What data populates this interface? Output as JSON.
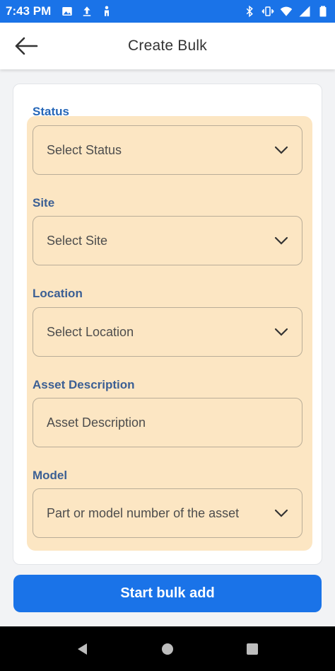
{
  "status_bar": {
    "time": "7:43 PM",
    "left_icons": [
      "image-icon",
      "upload-icon",
      "accessibility-icon"
    ],
    "right_icons": [
      "bluetooth-icon",
      "vibrate-icon",
      "wifi-icon",
      "signal-icon",
      "battery-icon"
    ]
  },
  "app_bar": {
    "title": "Create Bulk",
    "back_icon": "arrow-left-icon"
  },
  "form": {
    "status": {
      "label": "Status",
      "placeholder": "Select Status"
    },
    "site": {
      "label": "Site",
      "placeholder": "Select Site"
    },
    "location": {
      "label": "Location",
      "placeholder": "Select Location"
    },
    "asset_description": {
      "label": "Asset Description",
      "placeholder": "Asset Description"
    },
    "model": {
      "label": "Model",
      "placeholder": "Part or model number of the asset"
    }
  },
  "actions": {
    "start_label": "Start bulk add"
  },
  "colors": {
    "accent": "#1a73e8",
    "highlight": "#fce6c3",
    "label": "#3b5f94"
  }
}
